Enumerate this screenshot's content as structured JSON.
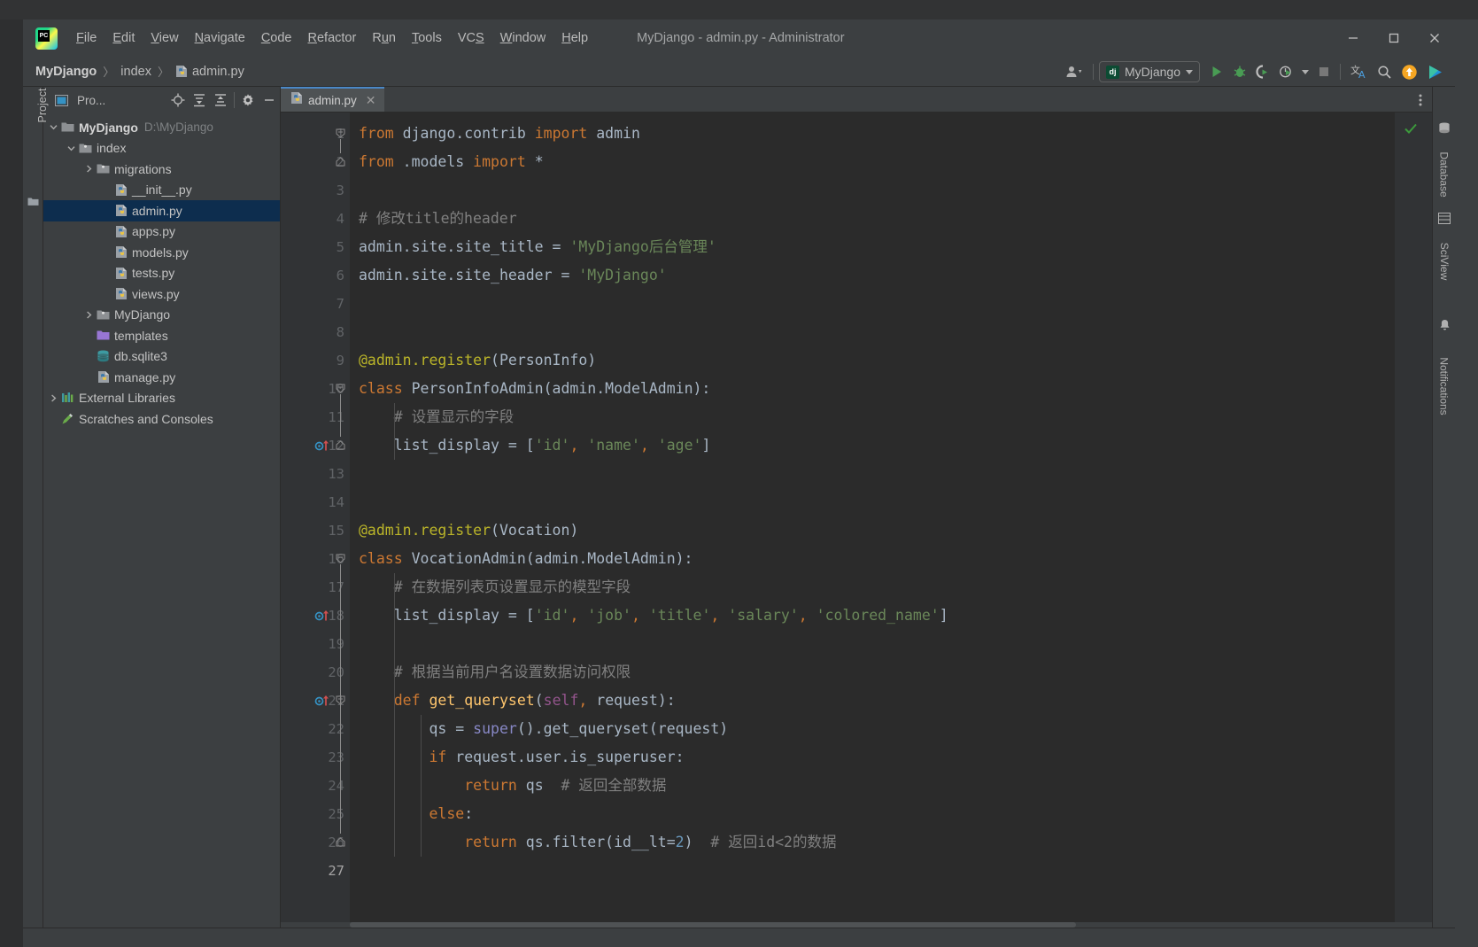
{
  "window": {
    "title": "MyDjango - admin.py - Administrator",
    "logo": "pycharm-logo",
    "minimize": "—",
    "maximize": "□",
    "close": "✕"
  },
  "menu": [
    {
      "label": "File",
      "mnemonic": "F"
    },
    {
      "label": "Edit",
      "mnemonic": "E"
    },
    {
      "label": "View",
      "mnemonic": "V"
    },
    {
      "label": "Navigate",
      "mnemonic": "N"
    },
    {
      "label": "Code",
      "mnemonic": "C"
    },
    {
      "label": "Refactor",
      "mnemonic": "R"
    },
    {
      "label": "Run",
      "mnemonic": "u"
    },
    {
      "label": "Tools",
      "mnemonic": "T"
    },
    {
      "label": "VCS",
      "mnemonic": "S"
    },
    {
      "label": "Window",
      "mnemonic": "W"
    },
    {
      "label": "Help",
      "mnemonic": "H"
    }
  ],
  "breadcrumb": {
    "items": [
      "MyDjango",
      "index",
      "admin.py"
    ],
    "separator": "〉"
  },
  "toolbar": {
    "user_icon": "user-avatar-icon",
    "run_config": {
      "label": "MyDjango",
      "icon_text": "dj"
    },
    "run": "run-icon",
    "debug": "debug-icon",
    "coverage": "run-with-coverage-icon",
    "profile": "profile-icon",
    "stop": "stop-icon",
    "translate": "translate-icon",
    "search": "search-everywhere-icon",
    "update": "update-project-icon",
    "extra": "play-gradient-icon"
  },
  "project_panel": {
    "vertical_label": "Project",
    "title": "Pro...",
    "actions": [
      "locate-icon",
      "expand-all-icon",
      "collapse-all-icon",
      "settings-icon",
      "hide-icon"
    ],
    "tree": [
      {
        "label": "MyDjango",
        "path": "D:\\MyDjango",
        "depth": 0,
        "icon": "folder-module",
        "arrow": "down",
        "bold": true,
        "selected": false
      },
      {
        "label": "index",
        "path": "",
        "depth": 1,
        "icon": "folder-package",
        "arrow": "down",
        "bold": false,
        "selected": false
      },
      {
        "label": "migrations",
        "path": "",
        "depth": 2,
        "icon": "folder-package",
        "arrow": "right",
        "bold": false,
        "selected": false
      },
      {
        "label": "__init__.py",
        "path": "",
        "depth": 3,
        "icon": "python-file",
        "arrow": "none",
        "bold": false,
        "selected": false
      },
      {
        "label": "admin.py",
        "path": "",
        "depth": 3,
        "icon": "python-file",
        "arrow": "none",
        "bold": false,
        "selected": true
      },
      {
        "label": "apps.py",
        "path": "",
        "depth": 3,
        "icon": "python-file",
        "arrow": "none",
        "bold": false,
        "selected": false
      },
      {
        "label": "models.py",
        "path": "",
        "depth": 3,
        "icon": "python-file",
        "arrow": "none",
        "bold": false,
        "selected": false
      },
      {
        "label": "tests.py",
        "path": "",
        "depth": 3,
        "icon": "python-file",
        "arrow": "none",
        "bold": false,
        "selected": false
      },
      {
        "label": "views.py",
        "path": "",
        "depth": 3,
        "icon": "python-file",
        "arrow": "none",
        "bold": false,
        "selected": false
      },
      {
        "label": "MyDjango",
        "path": "",
        "depth": 2,
        "icon": "folder-package",
        "arrow": "right",
        "bold": false,
        "selected": false
      },
      {
        "label": "templates",
        "path": "",
        "depth": 2,
        "icon": "folder-templates",
        "arrow": "none",
        "bold": false,
        "selected": false
      },
      {
        "label": "db.sqlite3",
        "path": "",
        "depth": 2,
        "icon": "database-file",
        "arrow": "none",
        "bold": false,
        "selected": false
      },
      {
        "label": "manage.py",
        "path": "",
        "depth": 2,
        "icon": "python-file",
        "arrow": "none",
        "bold": false,
        "selected": false
      },
      {
        "label": "External Libraries",
        "path": "",
        "depth": 0,
        "icon": "libraries",
        "arrow": "right",
        "bold": false,
        "selected": false
      },
      {
        "label": "Scratches and Consoles",
        "path": "",
        "depth": 0,
        "icon": "scratches",
        "arrow": "none",
        "bold": false,
        "selected": false
      }
    ]
  },
  "editor": {
    "tab": {
      "label": "admin.py",
      "icon": "python-file",
      "close": "✕"
    },
    "options_icon": "more-options-icon",
    "inspection_status": "ok-checkmark",
    "file_name": "admin.py",
    "line_count": 27,
    "lines": [
      {
        "n": 1,
        "fold": "start",
        "gicon": "",
        "text": "from django.contrib import admin"
      },
      {
        "n": 2,
        "fold": "end",
        "gicon": "",
        "text": "from .models import *"
      },
      {
        "n": 3,
        "fold": "",
        "gicon": "",
        "text": ""
      },
      {
        "n": 4,
        "fold": "",
        "gicon": "",
        "text": "# 修改title的header"
      },
      {
        "n": 5,
        "fold": "",
        "gicon": "",
        "text": "admin.site.site_title = 'MyDjango后台管理'"
      },
      {
        "n": 6,
        "fold": "",
        "gicon": "",
        "text": "admin.site.site_header = 'MyDjango'"
      },
      {
        "n": 7,
        "fold": "",
        "gicon": "",
        "text": ""
      },
      {
        "n": 8,
        "fold": "",
        "gicon": "",
        "text": ""
      },
      {
        "n": 9,
        "fold": "",
        "gicon": "",
        "text": "@admin.register(PersonInfo)"
      },
      {
        "n": 10,
        "fold": "start",
        "gicon": "",
        "text": "class PersonInfoAdmin(admin.ModelAdmin):"
      },
      {
        "n": 11,
        "fold": "",
        "gicon": "",
        "text": "    # 设置显示的字段"
      },
      {
        "n": 12,
        "fold": "end",
        "gicon": "override",
        "text": "    list_display = ['id', 'name', 'age']"
      },
      {
        "n": 13,
        "fold": "",
        "gicon": "",
        "text": ""
      },
      {
        "n": 14,
        "fold": "",
        "gicon": "",
        "text": ""
      },
      {
        "n": 15,
        "fold": "",
        "gicon": "",
        "text": "@admin.register(Vocation)"
      },
      {
        "n": 16,
        "fold": "start",
        "gicon": "",
        "text": "class VocationAdmin(admin.ModelAdmin):"
      },
      {
        "n": 17,
        "fold": "",
        "gicon": "",
        "text": "    # 在数据列表页设置显示的模型字段"
      },
      {
        "n": 18,
        "fold": "",
        "gicon": "override",
        "text": "    list_display = ['id', 'job', 'title', 'salary', 'colored_name']"
      },
      {
        "n": 19,
        "fold": "",
        "gicon": "",
        "text": ""
      },
      {
        "n": 20,
        "fold": "",
        "gicon": "",
        "text": "    # 根据当前用户名设置数据访问权限"
      },
      {
        "n": 21,
        "fold": "start",
        "gicon": "override",
        "text": "    def get_queryset(self, request):"
      },
      {
        "n": 22,
        "fold": "",
        "gicon": "",
        "text": "        qs = super().get_queryset(request)"
      },
      {
        "n": 23,
        "fold": "",
        "gicon": "",
        "text": "        if request.user.is_superuser:"
      },
      {
        "n": 24,
        "fold": "",
        "gicon": "",
        "text": "            return qs  # 返回全部数据"
      },
      {
        "n": 25,
        "fold": "",
        "gicon": "",
        "text": "        else:"
      },
      {
        "n": 26,
        "fold": "end",
        "gicon": "",
        "text": "            return qs.filter(id__lt=2)  # 返回id<2的数据"
      },
      {
        "n": 27,
        "fold": "",
        "gicon": "",
        "text": ""
      }
    ]
  },
  "right_tools": [
    {
      "label": "Database",
      "icon": "database-icon"
    },
    {
      "label": "SciView",
      "icon": "sciview-icon"
    },
    {
      "label": "Notifications",
      "icon": "notifications-icon"
    }
  ],
  "colors": {
    "background": "#2b2b2b",
    "panel": "#3c3f41",
    "gutter": "#313335",
    "selection": "#0d2d4e",
    "tab_active": "#4e5254",
    "tab_underline": "#4a88c7",
    "keyword": "#cc7832",
    "string": "#6a8759",
    "comment": "#808080",
    "decorator": "#bbb529",
    "function": "#ffc66d",
    "self": "#94558d",
    "builtin": "#8888c6",
    "number": "#6897bb",
    "default_text": "#a9b7c6",
    "run_green": "#499c54",
    "update_orange": "#f5a623"
  }
}
